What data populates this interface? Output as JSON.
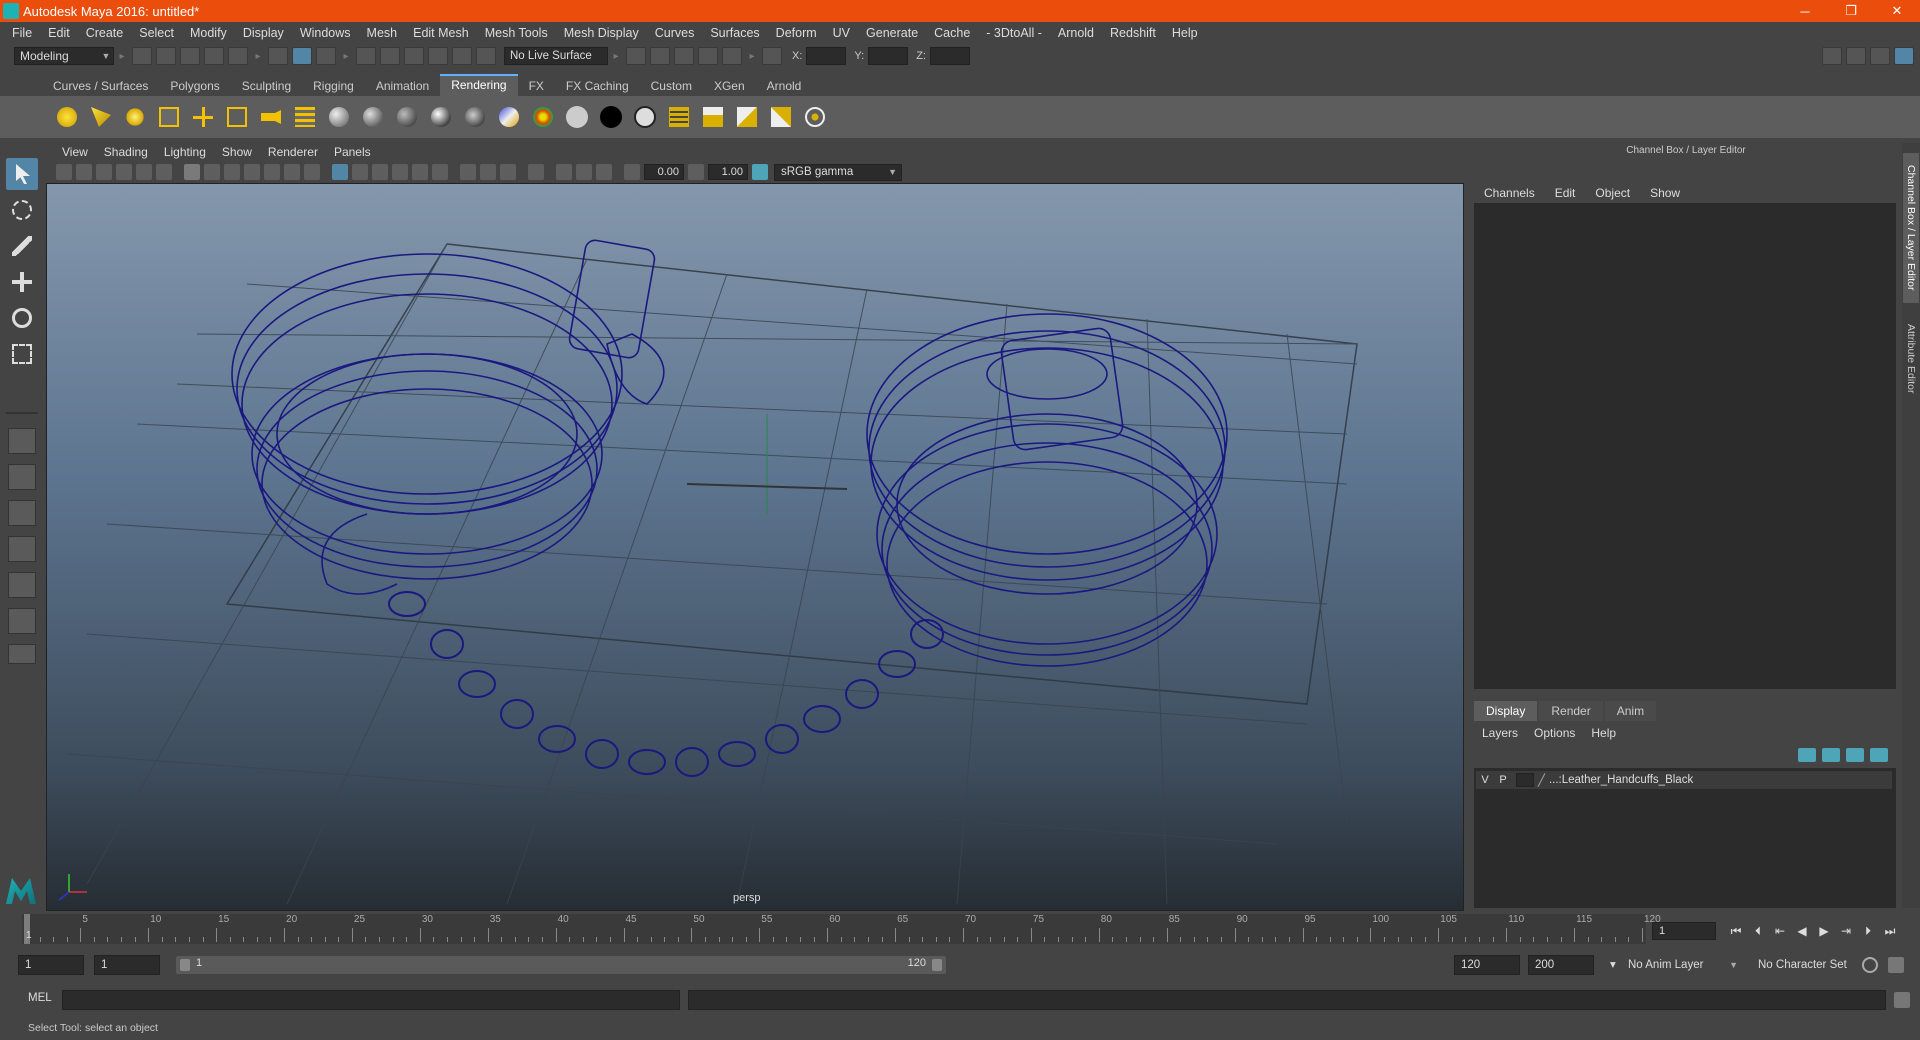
{
  "window": {
    "title": "Autodesk Maya 2016: untitled*",
    "controls": [
      "─",
      "❐",
      "✕"
    ]
  },
  "menubar": [
    "File",
    "Edit",
    "Create",
    "Select",
    "Modify",
    "Display",
    "Windows",
    "Mesh",
    "Edit Mesh",
    "Mesh Tools",
    "Mesh Display",
    "Curves",
    "Surfaces",
    "Deform",
    "UV",
    "Generate",
    "Cache",
    "- 3DtoAll -",
    "Arnold",
    "Redshift",
    "Help"
  ],
  "statusline": {
    "mode": "Modeling",
    "live_surface": "No Live Surface",
    "x_label": "X:",
    "y_label": "Y:",
    "z_label": "Z:"
  },
  "shelf_tabs": [
    "Curves / Surfaces",
    "Polygons",
    "Sculpting",
    "Rigging",
    "Animation",
    "Rendering",
    "FX",
    "FX Caching",
    "Custom",
    "XGen",
    "Arnold"
  ],
  "shelf_active": "Rendering",
  "shelf_icons": [
    "directional-light-icon",
    "spot-light-icon",
    "point-light-icon",
    "area-light-icon",
    "ambient-light-icon",
    "volume-light-icon",
    "camera-icon",
    "render-settings-icon",
    "sphere-shader-1",
    "sphere-shader-2",
    "sphere-shader-3",
    "sphere-shader-4",
    "sphere-shader-5",
    "ramp-icon",
    "color-sphere-icon",
    "white-sphere-icon",
    "black-sphere-icon",
    "white-sphere-icon-2",
    "render-view-icon",
    "ipr-icon",
    "render-icon",
    "batch-render-icon",
    "hypershade-icon"
  ],
  "viewport": {
    "menus": [
      "View",
      "Shading",
      "Lighting",
      "Show",
      "Renderer",
      "Panels"
    ],
    "exposure": "0.00",
    "gamma_value": "1.00",
    "color_space": "sRGB gamma",
    "camera": "persp"
  },
  "right_panel": {
    "header": "Channel Box / Layer Editor",
    "channel_menu": [
      "Channels",
      "Edit",
      "Object",
      "Show"
    ],
    "layer_tabs": [
      "Display",
      "Render",
      "Anim"
    ],
    "layer_active": "Display",
    "layer_menu": [
      "Layers",
      "Options",
      "Help"
    ],
    "layer": {
      "v": "V",
      "p": "P",
      "name": "...:Leather_Handcuffs_Black"
    },
    "side_tabs": [
      "Channel Box / Layer Editor",
      "Attribute Editor"
    ]
  },
  "timeline": {
    "labels": [
      "5",
      "10",
      "15",
      "20",
      "25",
      "30",
      "35",
      "40",
      "45",
      "50",
      "55",
      "60",
      "65",
      "70",
      "75",
      "80",
      "85",
      "90",
      "95",
      "100",
      "105",
      "110",
      "115",
      "120"
    ],
    "start_label": "1",
    "current_frame": "1",
    "playback": [
      "⏮",
      "⏴",
      "⇤",
      "◀",
      "▶",
      "⇥",
      "⏵",
      "⏭"
    ]
  },
  "range": {
    "start": "1",
    "min": "1",
    "bar_start": "1",
    "bar_end": "120",
    "end": "120",
    "max": "200",
    "anim_layer": "No Anim Layer",
    "character_set": "No Character Set"
  },
  "cmdline": {
    "lang": "MEL"
  },
  "helpline": {
    "text": "Select Tool: select an object"
  }
}
